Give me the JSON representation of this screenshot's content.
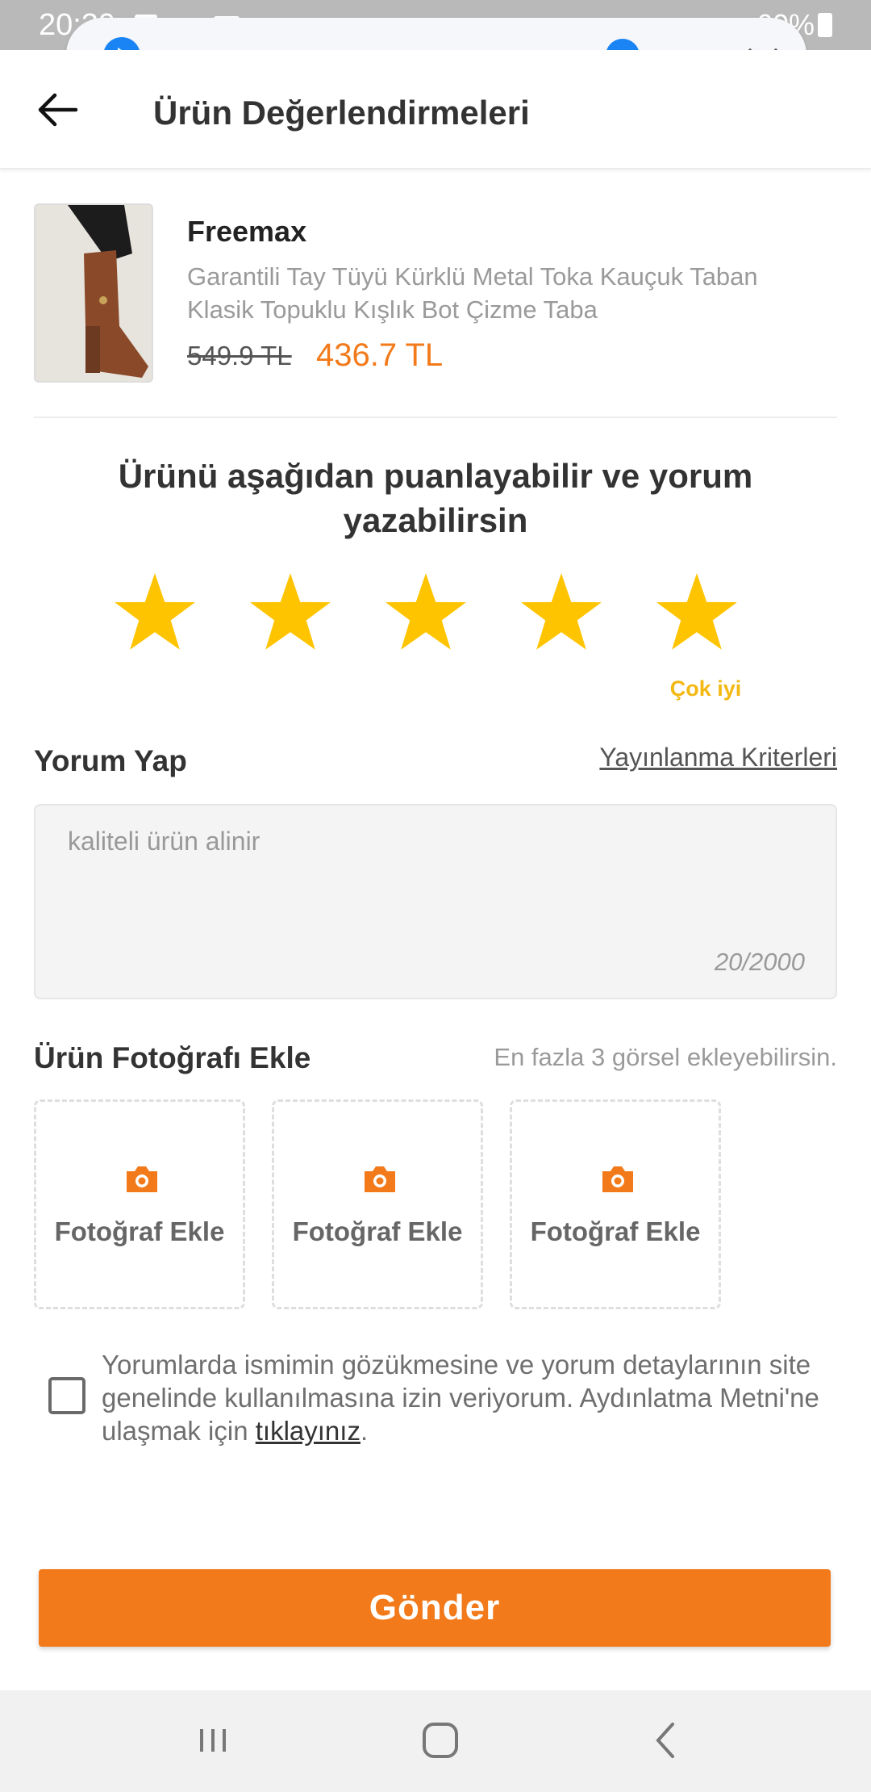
{
  "status_bar": {
    "time": "20:39",
    "battery": "60%"
  },
  "media_player": {
    "progress": 0.86
  },
  "header": {
    "title": "Ürün Değerlendirmeleri"
  },
  "product": {
    "brand": "Freemax",
    "name": "Garantili Tay Tüyü Kürklü Metal Toka Kauçuk Taban Klasik Topuklu Kışlık Bot Çizme Taba",
    "old_price": "549.9 TL",
    "new_price": "436.7 TL"
  },
  "rating": {
    "prompt": "Ürünü aşağıdan puanlayabilir ve yorum yazabilirsin",
    "value": 5,
    "max": 5,
    "label": "Çok iyi",
    "star_color": "#FFC400"
  },
  "comment": {
    "section_title": "Yorum Yap",
    "criteria_link": "Yayınlanma Kriterleri",
    "text": "kaliteli ürün alinir",
    "counter": "20/2000"
  },
  "photos": {
    "section_title": "Ürün Fotoğrafı Ekle",
    "hint": "En fazla 3 görsel ekleyebilirsin.",
    "slots": [
      {
        "label": "Fotoğraf Ekle",
        "icon": "camera-icon"
      },
      {
        "label": "Fotoğraf Ekle",
        "icon": "camera-icon"
      },
      {
        "label": "Fotoğraf Ekle",
        "icon": "camera-icon"
      }
    ]
  },
  "consent": {
    "checked": false,
    "text_before": "Yorumlarda ismimin gözükmesine ve yorum detaylarının site genelinde kullanılmasına izin veriyorum. Aydınlatma Metni'ne ulaşmak için ",
    "link_text": "tıklayınız",
    "text_after": "."
  },
  "submit_label": "Gönder",
  "colors": {
    "accent": "#F27A1A",
    "star": "#FFC400",
    "rating_label": "#F3B812",
    "player_blue": "#1A84F4"
  },
  "nav": {
    "icons": [
      "recents-icon",
      "home-icon",
      "back-icon"
    ]
  }
}
